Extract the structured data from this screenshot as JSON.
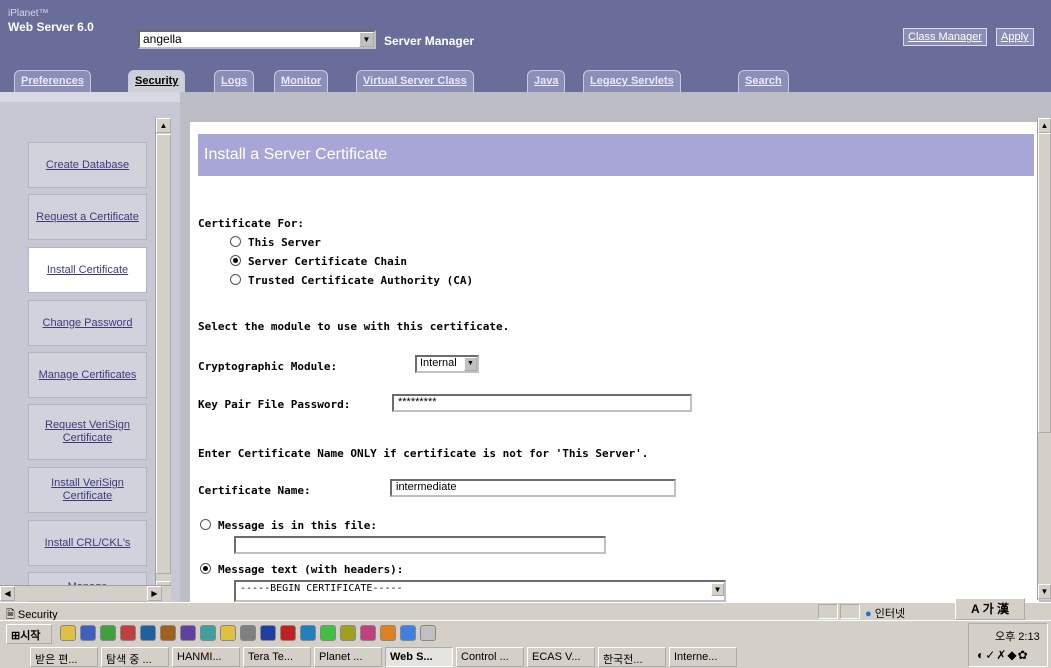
{
  "header": {
    "brand_small": "iPlanet™",
    "brand_big": "Web Server 6.0",
    "server_value": "angella",
    "title": "Server Manager",
    "class_manager": "Class Manager",
    "apply": "Apply"
  },
  "tabs": [
    "Preferences",
    "Security",
    "Logs",
    "Monitor",
    "Virtual Server Class",
    "Java",
    "Legacy Servlets",
    "Search"
  ],
  "nav": [
    {
      "label": "Create Database"
    },
    {
      "label": "Request a Certificate"
    },
    {
      "label": "Install Certificate"
    },
    {
      "label": "Change Password"
    },
    {
      "label": "Manage Certificates"
    },
    {
      "label": "Request VeriSign Certificate"
    },
    {
      "label": "Install VeriSign Certificate"
    },
    {
      "label": "Install CRL/CKL's"
    },
    {
      "label": "Manage"
    }
  ],
  "form": {
    "banner": "Install a Server Certificate",
    "cert_for_label": "Certificate For:",
    "opt_this_server": "This Server",
    "opt_chain": "Server Certificate Chain",
    "opt_ca": "Trusted Certificate Authority (CA)",
    "module_text": "Select the module to use with this certificate.",
    "crypto_label": "Cryptographic Module:",
    "crypto_value": "Internal",
    "password_label": "Key Pair File Password:",
    "password_value": "*********",
    "name_note": "Enter Certificate Name ONLY if certificate is not for 'This Server'.",
    "cert_name_label": "Certificate Name:",
    "cert_name_value": "intermediate",
    "msg_file_label": "Message is in this file:",
    "msg_text_label": "Message text (with headers):",
    "msg_text_value": "-----BEGIN CERTIFICATE-----"
  },
  "status": {
    "text": "Security",
    "zone": "인터넷",
    "ime": "A 가 漢"
  },
  "taskbar": {
    "start": "시작",
    "tasks": [
      "받은 편...",
      "탐색 중 ...",
      "HANMI...",
      "Tera Te...",
      "Planet ...",
      "Web S...",
      "Control ...",
      "ECAS V...",
      "한국전...",
      "Interne..."
    ],
    "clock": "오후 2:13"
  },
  "colors": {
    "header_bg": "#6a6d9a",
    "banner_bg": "#a8a6d6",
    "nav_link": "#3a3c7a"
  }
}
